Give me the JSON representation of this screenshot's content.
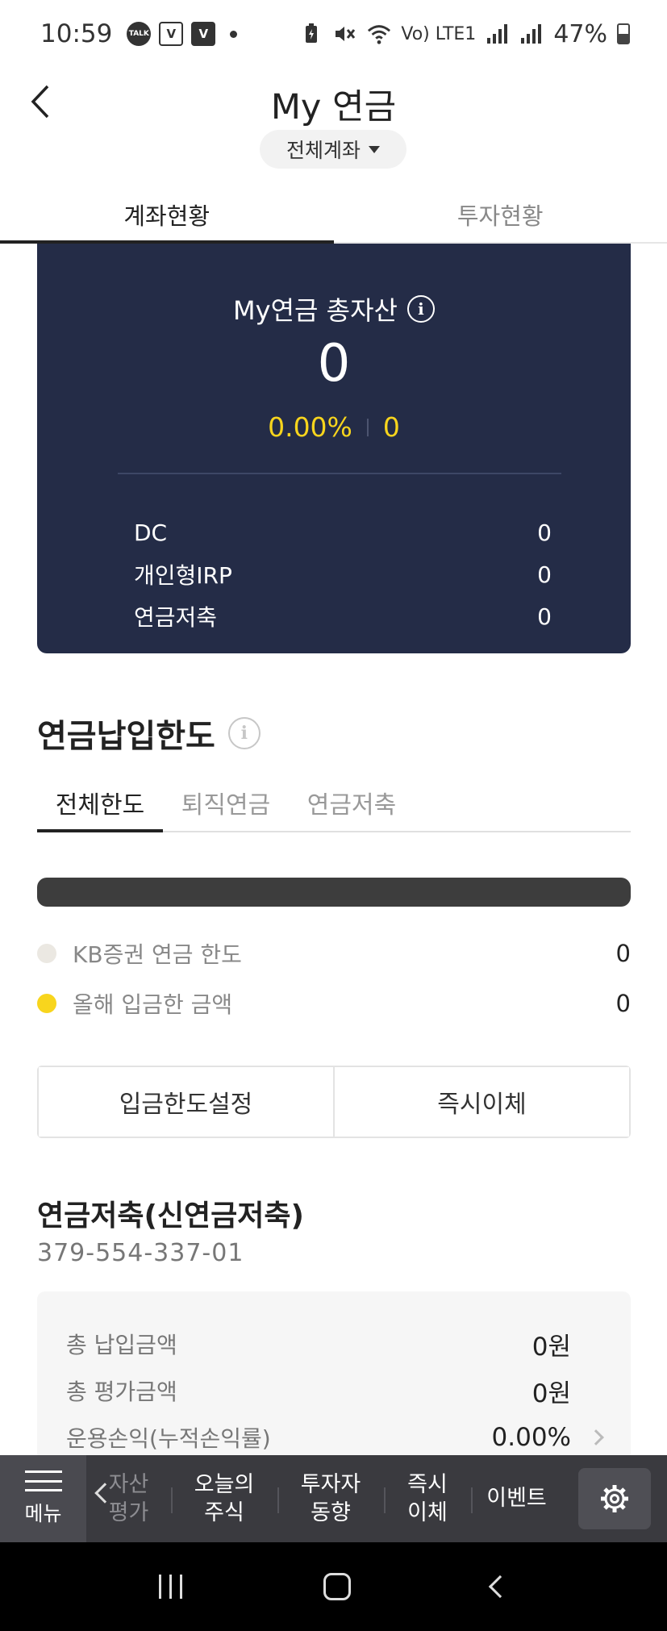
{
  "status_bar": {
    "time": "10:59",
    "notification_icons": [
      "talk-icon",
      "v-icon",
      "v-box-icon"
    ],
    "network_label": "Vo) LTE1",
    "battery": "47%"
  },
  "header": {
    "title": "My 연금",
    "account_select": "전체계좌"
  },
  "main_tabs": [
    {
      "label": "계좌현황",
      "active": true
    },
    {
      "label": "투자현황",
      "active": false
    }
  ],
  "summary": {
    "title": "My연금 총자산",
    "total": "0",
    "change_rate": "0.00%",
    "change_amount": "0",
    "rows": [
      {
        "label": "DC",
        "value": "0"
      },
      {
        "label": "개인형IRP",
        "value": "0"
      },
      {
        "label": "연금저축",
        "value": "0"
      }
    ],
    "colors": {
      "card_bg": "#242c47",
      "accent": "#f8d51d"
    }
  },
  "limit_section": {
    "title": "연금납입한도",
    "tabs": [
      {
        "label": "전체한도",
        "active": true
      },
      {
        "label": "퇴직연금",
        "active": false
      },
      {
        "label": "연금저축",
        "active": false
      }
    ],
    "progress": 0,
    "legend": [
      {
        "label": "KB증권 연금 한도",
        "value": "0",
        "color": "#ebe8e2"
      },
      {
        "label": "올해 입금한 금액",
        "value": "0",
        "color": "#f8d51d"
      }
    ],
    "buttons": {
      "set_limit": "입금한도설정",
      "transfer": "즉시이체"
    }
  },
  "account": {
    "name": "연금저축(신연금저축)",
    "number": "379-554-337-01",
    "rows": [
      {
        "label": "총 납입금액",
        "value": "0원"
      },
      {
        "label": "총 평가금액",
        "value": "0원"
      },
      {
        "label": "운용손익(누적손익률)",
        "value": "0.00%"
      }
    ]
  },
  "bottom_menu": {
    "menu_label": "메뉴",
    "items": [
      {
        "label": "자산\n평가",
        "faded": true
      },
      {
        "label": "오늘의\n주식",
        "faded": false
      },
      {
        "label": "투자자\n동향",
        "faded": false
      },
      {
        "label": "즉시\n이체",
        "faded": false
      },
      {
        "label": "이벤트",
        "faded": false
      }
    ]
  }
}
